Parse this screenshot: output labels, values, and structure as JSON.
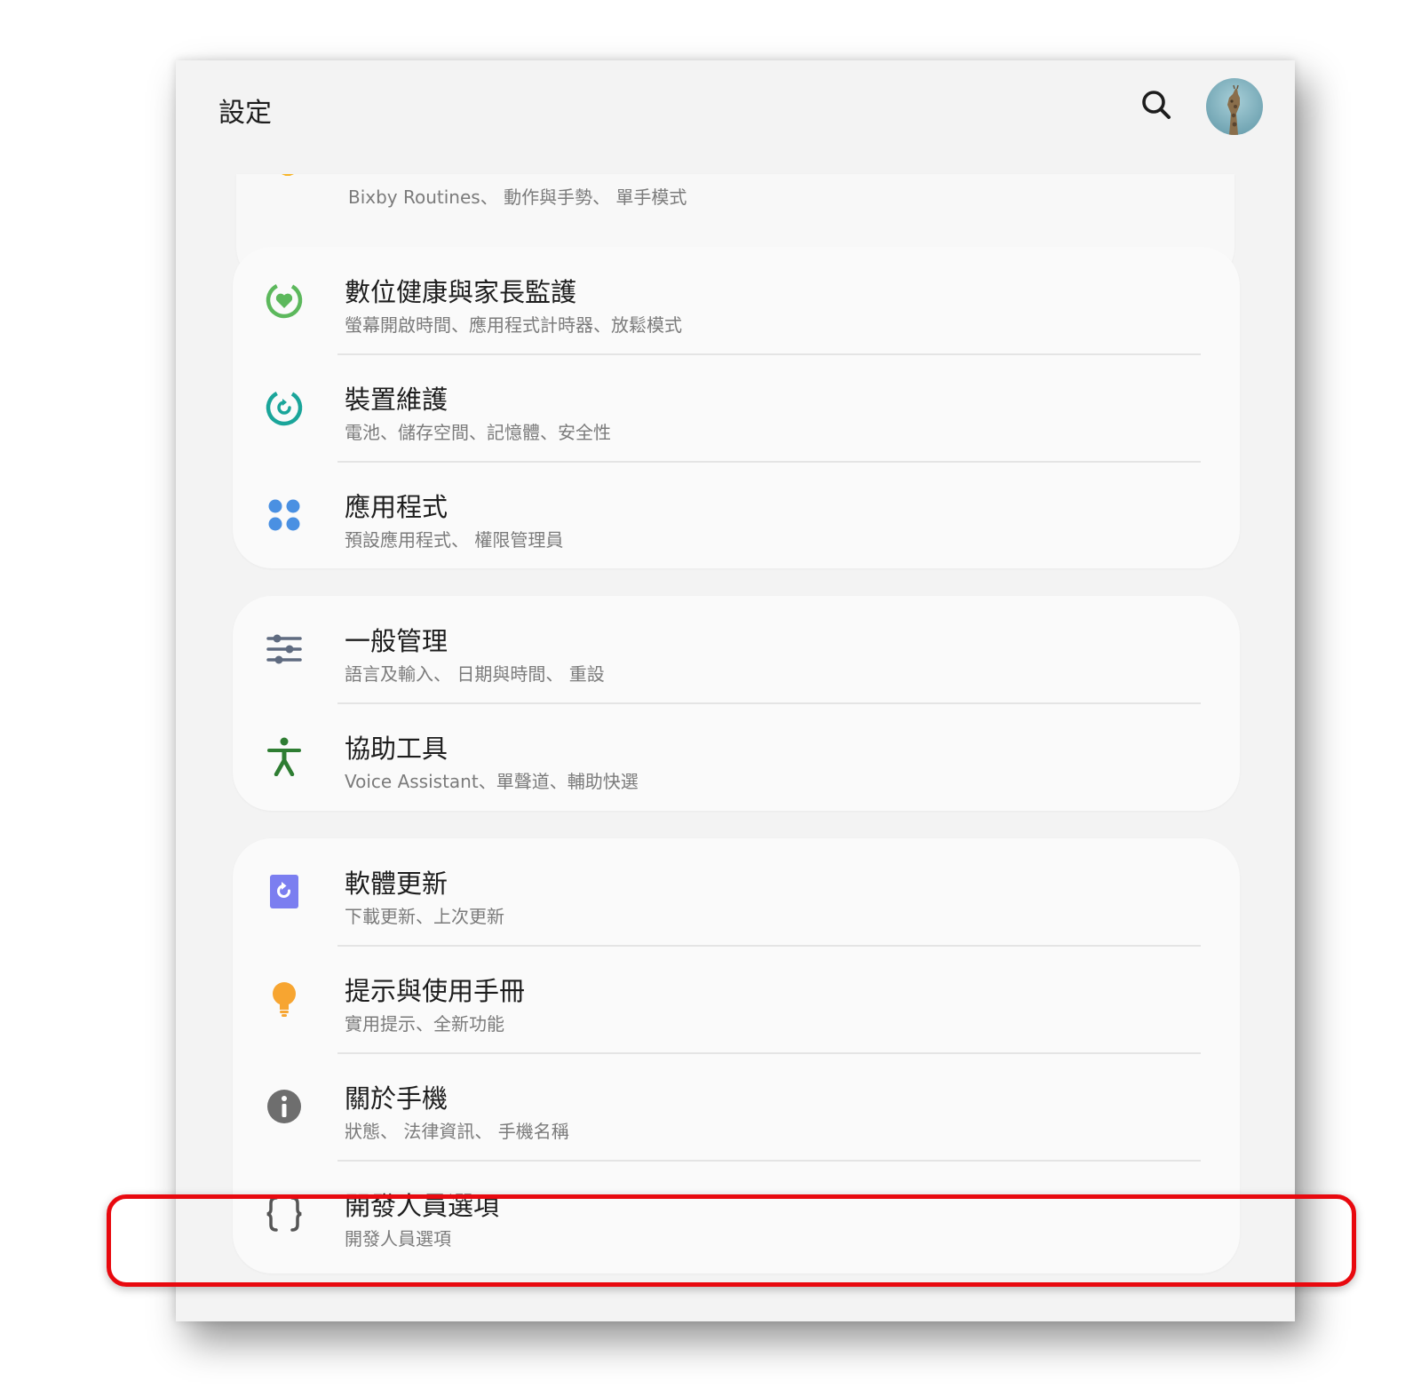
{
  "header": {
    "title": "設定"
  },
  "partial_item": {
    "subtitle": "Bixby Routines、 動作與手勢、 單手模式",
    "icon": "advanced-features-icon"
  },
  "groups": [
    {
      "items": [
        {
          "title": "數位健康與家長監護",
          "subtitle": "螢幕開啟時間、應用程式計時器、放鬆模式",
          "icon": "digital-wellbeing-icon",
          "color": "#5cb85c"
        },
        {
          "title": "裝置維護",
          "subtitle": "電池、儲存空間、記憶體、安全性",
          "icon": "device-care-icon",
          "color": "#1aa59a"
        },
        {
          "title": "應用程式",
          "subtitle": "預設應用程式、 權限管理員",
          "icon": "apps-icon",
          "color": "#4a90e2"
        }
      ]
    },
    {
      "items": [
        {
          "title": "一般管理",
          "subtitle": "語言及輸入、 日期與時間、 重設",
          "icon": "general-management-icon",
          "color": "#5f6b80"
        },
        {
          "title": "協助工具",
          "subtitle": "Voice Assistant、單聲道、輔助快選",
          "icon": "accessibility-icon",
          "color": "#2e7d32"
        }
      ]
    },
    {
      "items": [
        {
          "title": "軟體更新",
          "subtitle": "下載更新、上次更新",
          "icon": "software-update-icon",
          "color": "#7b7ef0"
        },
        {
          "title": "提示與使用手冊",
          "subtitle": "實用提示、全新功能",
          "icon": "tips-bulb-icon",
          "color": "#f7a531"
        },
        {
          "title": "關於手機",
          "subtitle": "狀態、 法律資訊、 手機名稱",
          "icon": "info-icon",
          "color": "#6e6e6e"
        },
        {
          "title": "開發人員選項",
          "subtitle": "開發人員選項",
          "icon": "developer-braces-icon",
          "color": "#555555"
        }
      ]
    }
  ]
}
